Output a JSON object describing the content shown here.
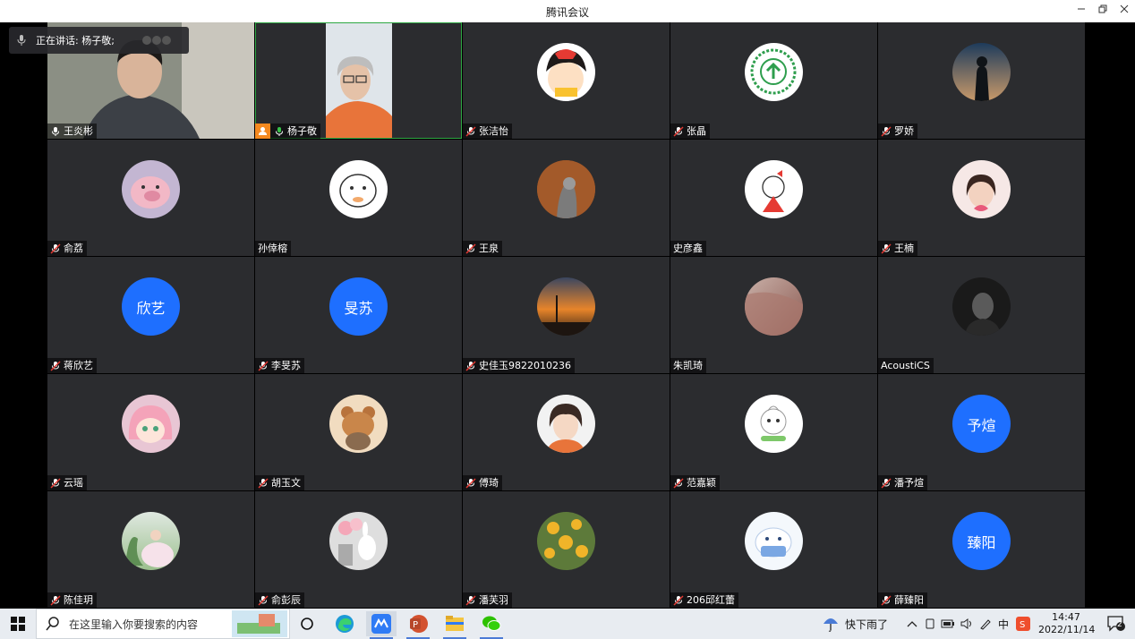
{
  "window": {
    "title": "腾讯会议"
  },
  "speaking": {
    "text": "正在讲话: 杨子敬;"
  },
  "participants": [
    {
      "name": "王炎彬",
      "mic": "on"
    },
    {
      "name": "杨子敬",
      "mic": "on"
    },
    {
      "name": "张洁怡",
      "mic": "off"
    },
    {
      "name": "张晶",
      "mic": "off"
    },
    {
      "name": "罗娇",
      "mic": "off"
    },
    {
      "name": "俞荔",
      "mic": "off"
    },
    {
      "name": "孙倖榕",
      "mic": "none"
    },
    {
      "name": "王泉",
      "mic": "off"
    },
    {
      "name": "史彦鑫",
      "mic": "none"
    },
    {
      "name": "王楠",
      "mic": "off"
    },
    {
      "name": "蒋欣艺",
      "mic": "off",
      "avatar_text": "欣艺"
    },
    {
      "name": "李旻苏",
      "mic": "off",
      "avatar_text": "旻苏"
    },
    {
      "name": "史佳玉9822010236",
      "mic": "off"
    },
    {
      "name": "朱凯琦",
      "mic": "none"
    },
    {
      "name": "AcoustiCS",
      "mic": "none"
    },
    {
      "name": "云瑶",
      "mic": "off"
    },
    {
      "name": "胡玉文",
      "mic": "off"
    },
    {
      "name": "傅琦",
      "mic": "off"
    },
    {
      "name": "范嘉颖",
      "mic": "off"
    },
    {
      "name": "潘予煊",
      "mic": "off",
      "avatar_text": "予煊"
    },
    {
      "name": "陈佳玥",
      "mic": "off"
    },
    {
      "name": "俞彭辰",
      "mic": "off"
    },
    {
      "name": "潘芙羽",
      "mic": "off"
    },
    {
      "name": "206邱红蕾",
      "mic": "off"
    },
    {
      "name": "薛臻阳",
      "mic": "off",
      "avatar_text": "臻阳"
    }
  ],
  "taskbar": {
    "search_placeholder": "在这里输入你要搜索的内容",
    "weather": "快下雨了",
    "ime": "中",
    "time": "14:47",
    "date": "2022/11/14",
    "notifications": "2"
  },
  "colors": {
    "accent": "#1e6fff",
    "tile": "#2b2c2f",
    "active_border": "#2ea843",
    "mic_on": "#38c24a"
  }
}
